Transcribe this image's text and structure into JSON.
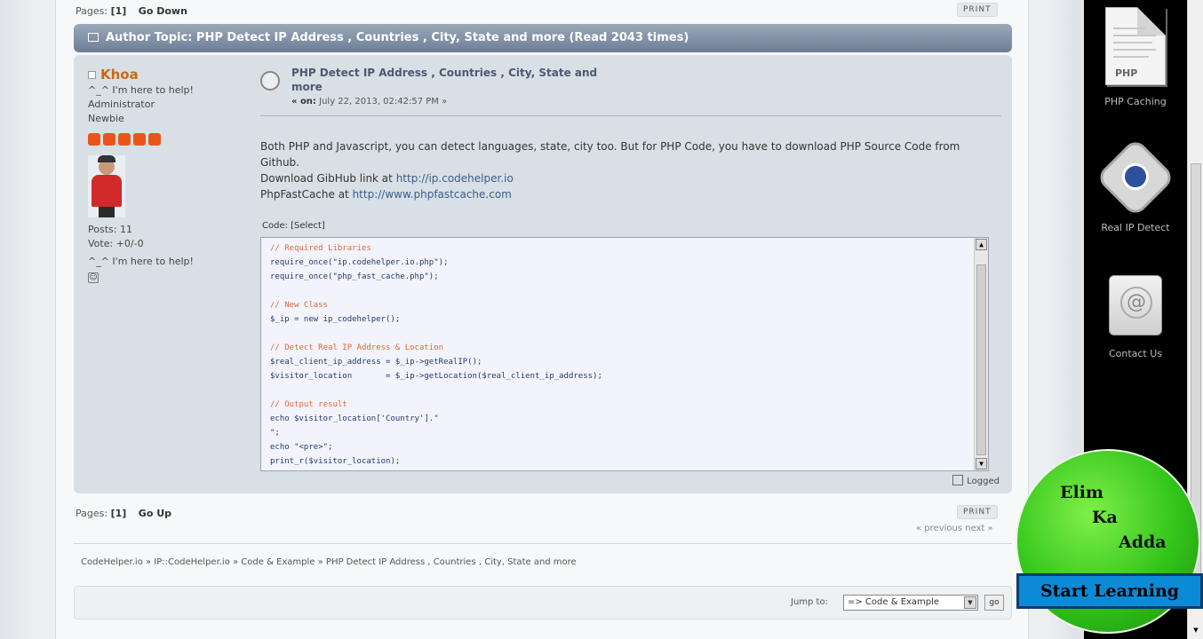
{
  "top_pagebar": {
    "pages_label": "Pages:",
    "current_page": "[1]",
    "go_link": "Go Down",
    "print": "PRINT"
  },
  "topic": {
    "title": "Author Topic: PHP Detect IP Address , Countries , City, State and more  (Read 2043 times)"
  },
  "poster": {
    "name": "Khoa",
    "tagline": "^_^ I'm here to help!",
    "role": "Administrator",
    "rank": "Newbie",
    "stars": 5,
    "posts": "Posts: 11",
    "vote": "Vote: +0/-0",
    "signature": "^_^ I'm here to help!"
  },
  "post": {
    "subject": "PHP Detect IP Address , Countries , City, State and more",
    "date_prefix": "« on:",
    "date": "July 22, 2013, 02:42:57 PM »",
    "body_line1": "Both PHP and Javascript, you can detect languages, state, city too. But for PHP Code, you have to download PHP Source Code from Github.",
    "download_label": "Download GibHub link at ",
    "download_link": "http://ip.codehelper.io",
    "cache_label": "PhpFastCache at ",
    "cache_link": "http://www.phpfastcache.com",
    "code_header": "Code: [Select]",
    "logged": "Logged"
  },
  "code_lines": [
    "// Required Libraries",
    "require_once(\"ip.codehelper.io.php\");",
    "require_once(\"php_fast_cache.php\");",
    "",
    "// New Class",
    "$_ip = new ip_codehelper();",
    "",
    "// Detect Real IP Address & Location",
    "$real_client_ip_address = $_ip->getRealIP();",
    "$visitor_location       = $_ip->getLocation($real_client_ip_address);",
    "",
    "// Output result",
    "echo $visitor_location['Country'].\"",
    "\";",
    "echo \"<pre>\";",
    "print_r($visitor_location);"
  ],
  "bottom_pagebar": {
    "pages_label": "Pages:",
    "current_page": "[1]",
    "go_link": "Go Up",
    "print": "PRINT",
    "prevnext": "« previous next »"
  },
  "linktree": "CodeHelper.io » IP::CodeHelper.io » Code & Example » PHP Detect IP Address , Countries , City, State and more",
  "jump": {
    "label": "Jump to:",
    "selected": "=> Code & Example",
    "go": "go"
  },
  "sidebar": {
    "items": [
      {
        "label": "PHP Caching",
        "icon": "php-document-icon",
        "doc_tag": "PHP"
      },
      {
        "label": "Real IP Detect",
        "icon": "cube-globe-icon"
      },
      {
        "label": "Contact Us",
        "icon": "address-book-icon"
      }
    ]
  },
  "badge": {
    "line1": "Elim",
    "line2": "Ka",
    "line3": "Adda",
    "button": "Start Learning"
  },
  "colors": {
    "category_bar": "#6d7e96",
    "post_bg": "#d8e0e6",
    "poster_name": "#c86a14",
    "stars": "#e8551a",
    "badge_green": "#32c41a",
    "start_button": "#0d8ad6"
  }
}
